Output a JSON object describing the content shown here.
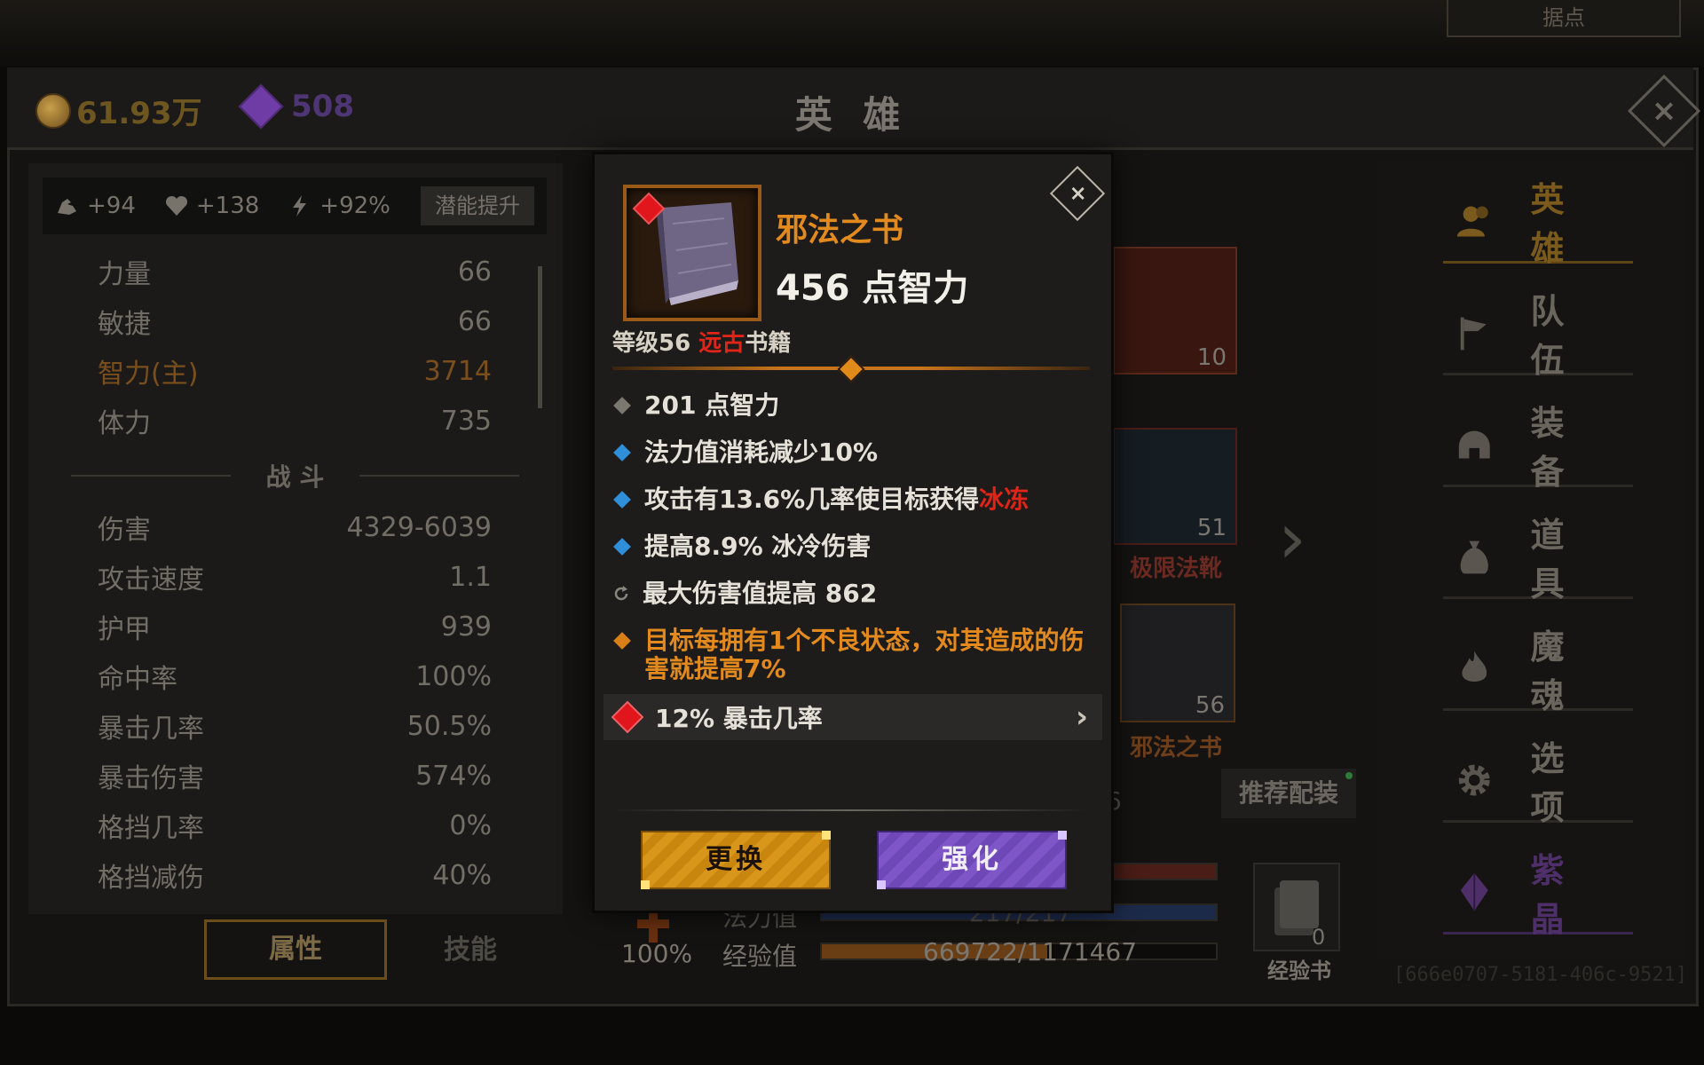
{
  "top_tab": {
    "label": "据点"
  },
  "header": {
    "gold": "61.93万",
    "gems": "508",
    "title": "英 雄"
  },
  "potential": {
    "strength_bonus": "+94",
    "health_bonus": "+138",
    "energy_bonus": "+92%",
    "button_label": "潜能提升"
  },
  "attributes": [
    {
      "name": "力量",
      "value": "66"
    },
    {
      "name": "敏捷",
      "value": "66"
    },
    {
      "name": "智力(主)",
      "value": "3714"
    },
    {
      "name": "体力",
      "value": "735"
    }
  ],
  "combat_header": "战 斗",
  "combat_stats": [
    {
      "name": "伤害",
      "value": "4329-6039"
    },
    {
      "name": "攻击速度",
      "value": "1.1"
    },
    {
      "name": "护甲",
      "value": "939"
    },
    {
      "name": "命中率",
      "value": "100%"
    },
    {
      "name": "暴击几率",
      "value": "50.5%"
    },
    {
      "name": "暴击伤害",
      "value": "574%"
    },
    {
      "name": "格挡几率",
      "value": "0%"
    },
    {
      "name": "格挡减伤",
      "value": "40%"
    }
  ],
  "bottom_tabs": {
    "attributes": "属性",
    "skills": "技能"
  },
  "equipment_slots": [
    {
      "level": "10",
      "name": ""
    },
    {
      "level": "51",
      "name": "极限法靴"
    },
    {
      "level": "56",
      "name": "邪法之书"
    }
  ],
  "recommend_button": "推荐配装",
  "partial_number": "6",
  "bars": {
    "mana_label": "法力值",
    "mana_value": "217/217",
    "exp_label": "经验值",
    "exp_value": "669722/1171467",
    "exp_fraction": 0.572,
    "health_fraction": 1.0,
    "mana_fraction": 1.0
  },
  "revive": {
    "percent": "100%"
  },
  "exp_book": {
    "count": "0",
    "label": "经验书"
  },
  "nav": [
    {
      "id": "hero",
      "label": "英 雄",
      "icon": "people-icon"
    },
    {
      "id": "team",
      "label": "队 伍",
      "icon": "flag-icon"
    },
    {
      "id": "equipment",
      "label": "装 备",
      "icon": "helmet-icon"
    },
    {
      "id": "items",
      "label": "道 具",
      "icon": "bag-icon"
    },
    {
      "id": "souls",
      "label": "魔 魂",
      "icon": "flame-icon"
    },
    {
      "id": "options",
      "label": "选 项",
      "icon": "gear-icon"
    },
    {
      "id": "crystal",
      "label": "紫 晶",
      "icon": "crystal-icon"
    }
  ],
  "id_text": "[666e0707-5181-406c-9521]",
  "item": {
    "name": "邪法之书",
    "main_stat": "456 点智力",
    "level_prefix": "等级56 ",
    "rarity": "远古",
    "type": "书籍",
    "quality_position": 0.5,
    "affixes": [
      {
        "bullet": "grey",
        "text": "201 点智力"
      },
      {
        "bullet": "blue",
        "text": "法力值消耗减少10%"
      },
      {
        "bullet": "blue",
        "text": "攻击有13.6%几率使目标获得",
        "highlight": "冰冻"
      },
      {
        "bullet": "blue",
        "text": "提高8.9% 冰冷伤害"
      },
      {
        "bullet": "reroll",
        "text": "最大伤害值提高 862"
      },
      {
        "bullet": "orange",
        "text": "目标每拥有1个不良状态，对其造成的伤害就提高7%"
      }
    ],
    "socket": "12% 暴击几率",
    "replace_button": "更换",
    "enhance_button": "强化"
  },
  "colors": {
    "legendary_orange": "#e38a1e",
    "ancient_red": "#e02418",
    "magic_blue": "#2f8fd8",
    "replace_gold": "#d8961a",
    "enhance_purple": "#7e56c8"
  }
}
